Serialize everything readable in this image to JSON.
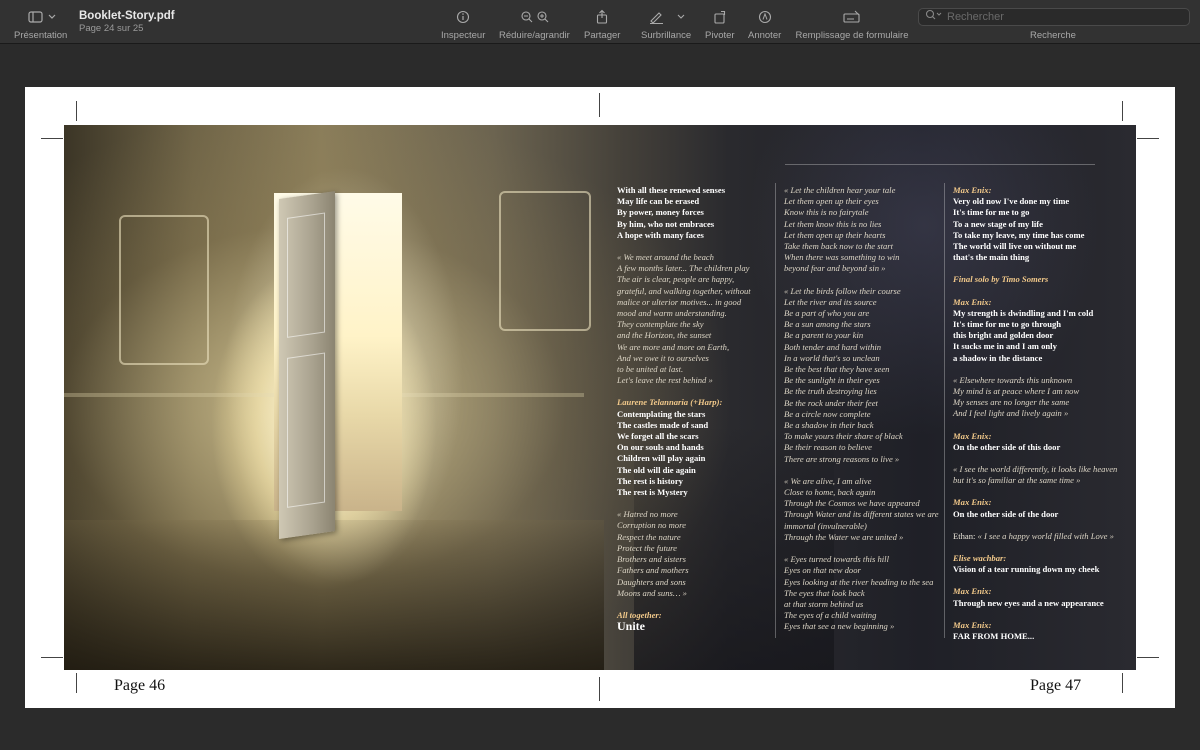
{
  "toolbar": {
    "sidebar_label": "Présentation",
    "doc_name": "Booklet-Story.pdf",
    "doc_page": "Page 24 sur 25",
    "inspector": "Inspecteur",
    "zoom": "Réduire/agrandir",
    "share": "Partager",
    "highlight": "Surbrillance",
    "rotate": "Pivoter",
    "annotate": "Annoter",
    "form_fill": "Remplissage de formulaire",
    "search_placeholder": "Rechercher",
    "search_label": "Recherche"
  },
  "pages": {
    "left": "Page 46",
    "right": "Page 47"
  },
  "col1": {
    "s1": [
      "With all these renewed senses",
      "May life can be erased",
      "By power, money forces",
      "By him, who not embraces",
      "A hope with many faces"
    ],
    "s2": [
      "« We meet around the beach",
      "A few months later... The children play",
      "The air is clear, people are happy,",
      "grateful, and walking together, without",
      "malice or ulterior motives... in good",
      "mood and warm understanding.",
      "They contemplate the sky",
      "and the Horizon, the sunset",
      "We are more and more on Earth,",
      "And we owe it to ourselves",
      "to be united at last.",
      "Let's leave the rest behind »"
    ],
    "s3_speaker": "Laurene Telannaria (+Harp):",
    "s3": [
      "Contemplating the stars",
      "The castles made of sand",
      "We forget all the scars",
      "On our souls and hands",
      "Children will play again",
      "The old will die again",
      "The rest is history",
      "The rest is Mystery"
    ],
    "s4": [
      "« Hatred no more",
      "Corruption no more",
      "Respect the nature",
      "Protect the future",
      "Brothers and sisters",
      "Fathers and mothers",
      "Daughters and sons",
      "Moons and suns… »"
    ],
    "s5_speaker": "All together:",
    "s5": "Unite"
  },
  "col2": {
    "s1": [
      "« Let the children hear your tale",
      "Let them open up their eyes",
      "Know this is no fairytale",
      "Let them know this is no lies",
      "Let them open up their hearts",
      "Take them back now to the start",
      "When there was something to win",
      "beyond fear and beyond sin »"
    ],
    "s2": [
      "« Let the birds follow their course",
      "Let the river and its source",
      "Be a part of who you are",
      "Be a sun among the stars",
      "Be a parent to your kin",
      "Both tender and hard within",
      "In a world that's so unclean",
      "Be the best that they have seen",
      "Be the sunlight in their eyes",
      "Be the truth destroying lies",
      "Be the rock under their feet",
      "Be a circle now complete",
      "Be a shadow in their back",
      "To make yours their share of black",
      "Be their reason to believe",
      "There are strong reasons to live »"
    ],
    "s3": [
      "« We are alive, I am alive",
      "Close to home, back again",
      "Through the Cosmos we have appeared",
      "Through Water and its different states we are",
      "immortal (invulnerable)",
      "Through the Water we are united »"
    ],
    "s4": [
      "« Eyes turned towards this hill",
      "Eyes on that new door",
      "Eyes looking at the river heading to the sea",
      "The eyes that look back",
      "at that storm behind us",
      "The eyes of a child waiting",
      "Eyes that see a new beginning »"
    ]
  },
  "col3": {
    "sp1": "Max Enix:",
    "s1": [
      "Very old now I've done my time",
      "It's time for me to go",
      "To a new stage of my life",
      "To take my leave, my time has come",
      "The world will live on without me",
      "that's the main thing"
    ],
    "solo": "Final solo by Timo Somers",
    "sp2": "Max Enix:",
    "s2": [
      "My strength is dwindling and I'm cold",
      "It's time for me to go through",
      "this bright and golden door",
      "It sucks me in and I am only",
      "a shadow in the distance"
    ],
    "s3": [
      "« Elsewhere towards this unknown",
      "My mind is at peace where I am now",
      "My senses are no longer the same",
      "And I feel light and lively again »"
    ],
    "sp4": "Max Enix:",
    "s4": "On the other side of this door",
    "s5": [
      "« I see the world differently, it looks like heaven",
      "but it's so familiar at the same time »"
    ],
    "sp6": "Max Enix:",
    "s6": "On the other side of the door",
    "s7_name": "Ethan:",
    "s7": "« I see a happy world filled with Love »",
    "sp8": "Elise wachbar:",
    "s8": "Vision of a tear running down my cheek",
    "sp9": "Max Enix:",
    "s9": "Through new eyes and a new appearance",
    "sp10": "Max Enix:",
    "s10": "FAR FROM HOME..."
  }
}
